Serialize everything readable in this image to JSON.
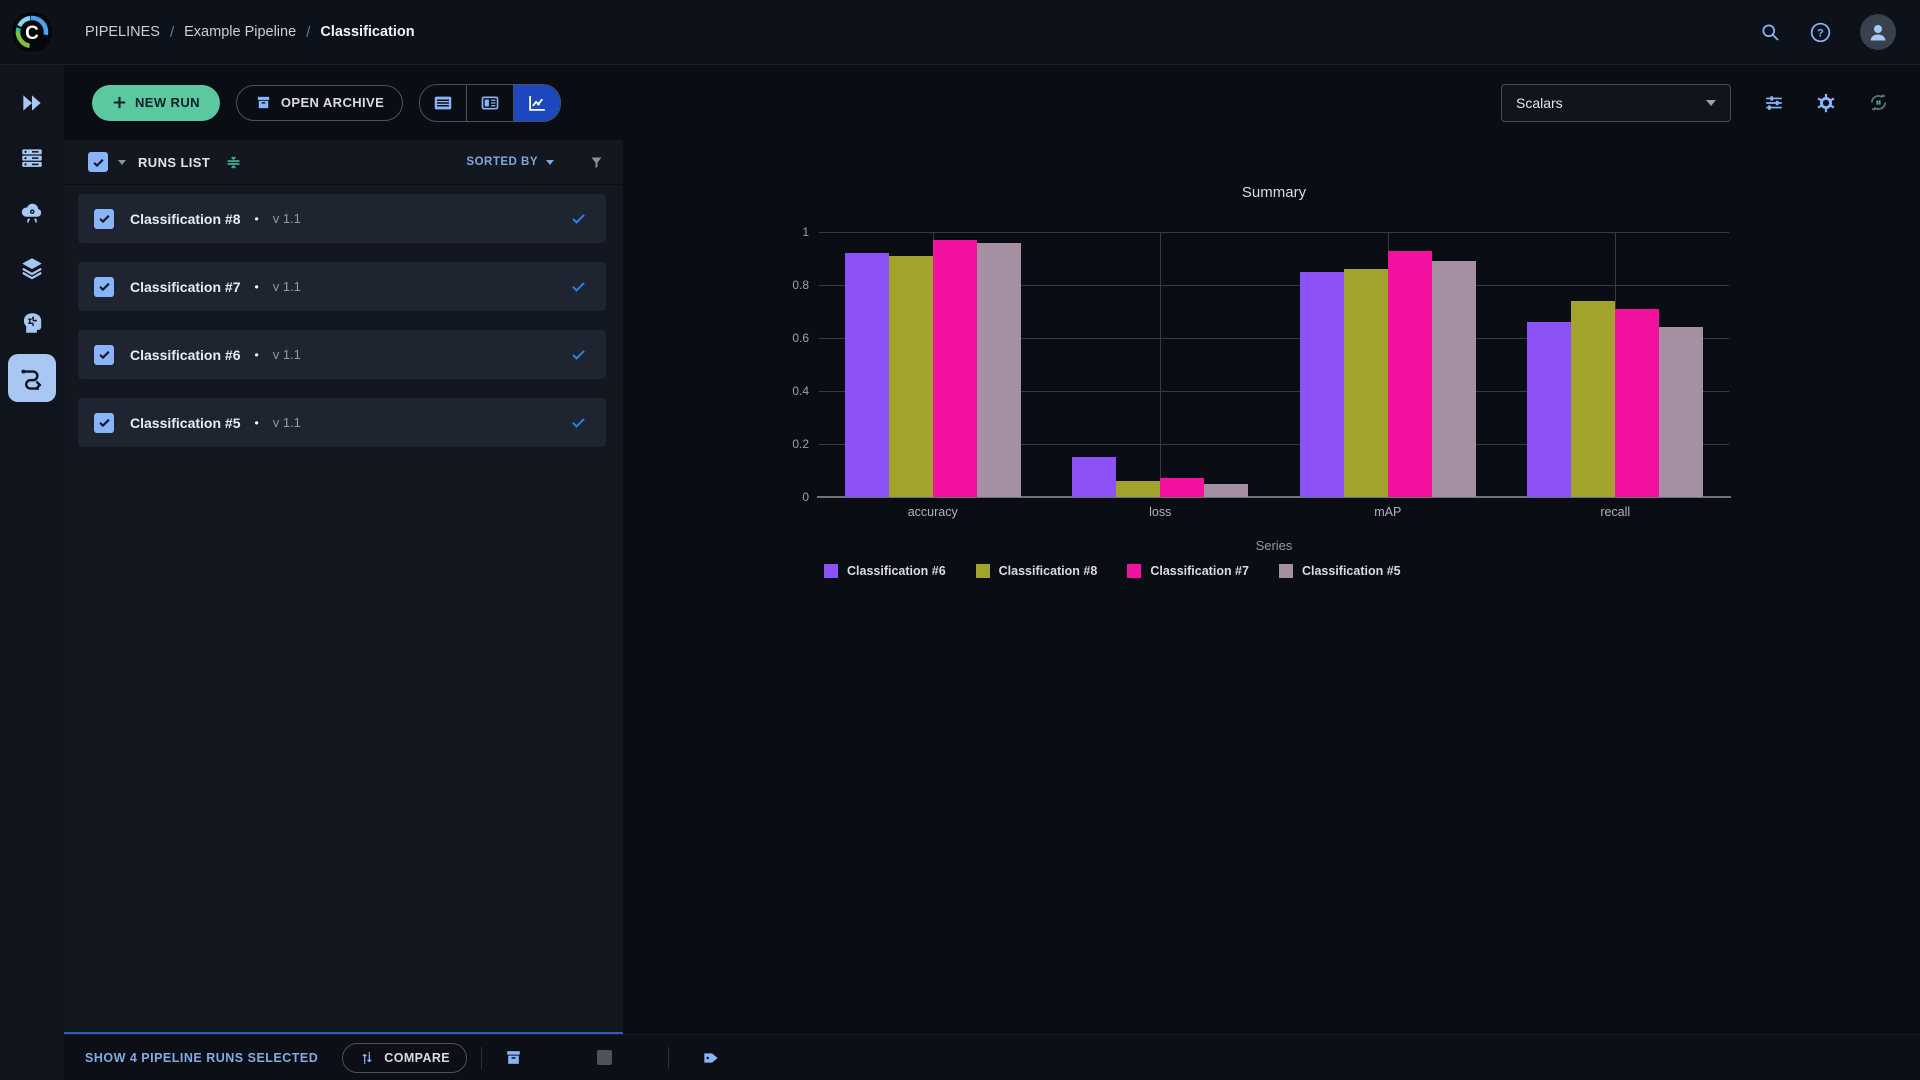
{
  "topbar": {
    "breadcrumb": {
      "root": "PIPELINES",
      "separator": "/",
      "project": "Example Pipeline",
      "current": "Classification"
    },
    "icons": [
      "search-icon",
      "help-icon",
      "user-avatar"
    ]
  },
  "toolbar": {
    "new_run_label": "NEW RUN",
    "open_archive_label": "OPEN ARCHIVE",
    "view_toggle": [
      "table-view-icon",
      "split-view-icon",
      "chart-view-icon"
    ],
    "active_view": "chart-view",
    "metric_dropdown_value": "Scalars",
    "right_icons": [
      "tune-icon",
      "settings-gear-icon",
      "auto-refresh-icon"
    ]
  },
  "runs_panel": {
    "header": {
      "title": "RUNS LIST",
      "select_all_checked": true,
      "sorted_by_label": "SORTED BY"
    },
    "runs": [
      {
        "name": "Classification #8",
        "version": "v 1.1",
        "checked": true,
        "selected_mark": true
      },
      {
        "name": "Classification #7",
        "version": "v 1.1",
        "checked": true,
        "selected_mark": true
      },
      {
        "name": "Classification #6",
        "version": "v 1.1",
        "checked": true,
        "selected_mark": true
      },
      {
        "name": "Classification #5",
        "version": "v 1.1",
        "checked": true,
        "selected_mark": true
      }
    ]
  },
  "chart_data": {
    "type": "bar",
    "title": "Summary",
    "categories": [
      "accuracy",
      "loss",
      "mAP",
      "recall"
    ],
    "series": [
      {
        "name": "Classification #6",
        "color": "#8c52f8",
        "values": [
          0.92,
          0.15,
          0.85,
          0.66
        ]
      },
      {
        "name": "Classification #8",
        "color": "#a1a32a",
        "values": [
          0.91,
          0.06,
          0.86,
          0.74
        ]
      },
      {
        "name": "Classification #7",
        "color": "#f2129f",
        "values": [
          0.97,
          0.07,
          0.93,
          0.71
        ]
      },
      {
        "name": "Classification #5",
        "color": "#a48fa3",
        "values": [
          0.96,
          0.05,
          0.89,
          0.64
        ]
      }
    ],
    "legend_title": "Series",
    "legend_position": "bottom",
    "ylim": [
      0,
      1
    ],
    "yticks": [
      0,
      0.2,
      0.4,
      0.6,
      0.8,
      1
    ],
    "grid": true
  },
  "footer": {
    "selected_text": "SHOW 4 PIPELINE RUNS SELECTED",
    "compare_label": "COMPARE",
    "icons": [
      "compare-icon",
      "archive-icon",
      "stop-icon",
      "tag-icon"
    ]
  },
  "colors": {
    "accent": "#8ab4f8",
    "new_run_green": "#5bc8a0",
    "active_view_blue": "#1c47bd",
    "row_check_blue": "#2e7fe0",
    "footer_text_blue": "#83abe3",
    "resize_bar_blue": "#2e5eba",
    "teal": "#3fbda8"
  }
}
